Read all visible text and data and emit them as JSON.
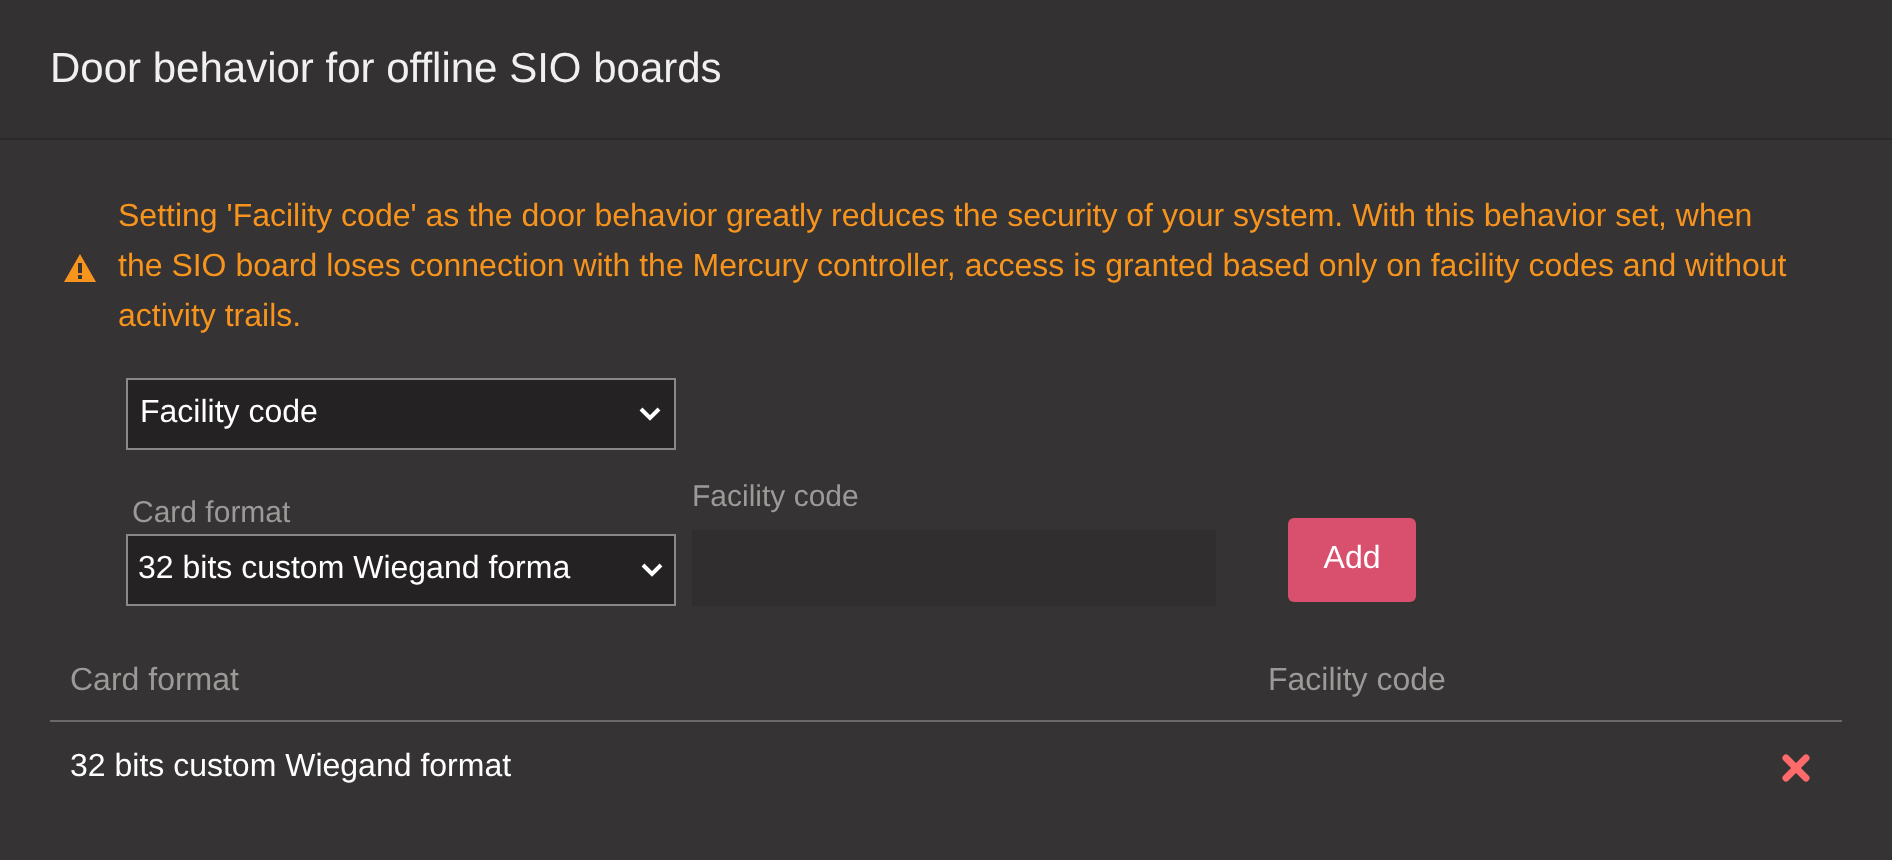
{
  "dialog": {
    "title": "Door behavior for offline SIO boards"
  },
  "warning": "Setting 'Facility code' as the door behavior greatly reduces the security of your system. With this behavior set, when the SIO board loses connection with the Mercury controller, access is granted based only on facility codes and without activity trails.",
  "behavior_select": {
    "value": "Facility code"
  },
  "card_format": {
    "label": "Card format",
    "value": "32 bits custom Wiegand forma"
  },
  "facility_code": {
    "label": "Facility code"
  },
  "add_button": "Add",
  "table": {
    "columns": [
      "Card format",
      "Facility code"
    ],
    "rows": [
      {
        "card_format": "32 bits custom Wiegand format"
      }
    ]
  }
}
